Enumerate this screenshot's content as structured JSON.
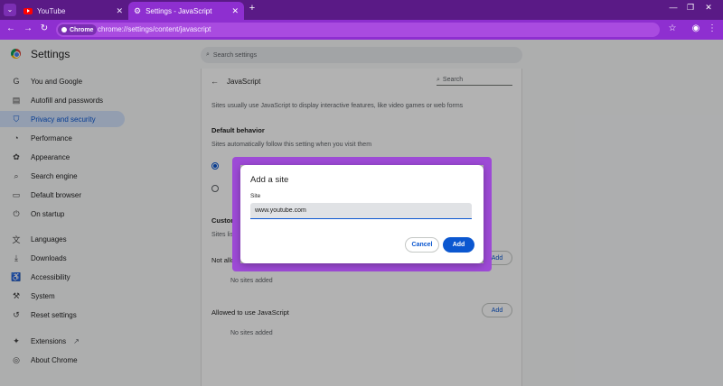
{
  "browser": {
    "tabs": [
      {
        "title": "YouTube",
        "icon": "youtube-icon",
        "active": false
      },
      {
        "title": "Settings - JavaScript",
        "icon": "gear-icon",
        "active": true
      }
    ],
    "new_tab_symbol": "+",
    "url_chip": "Chrome",
    "url": "chrome://settings/content/javascript",
    "accent_color": "#8e2fd0"
  },
  "header": {
    "title": "Settings",
    "search_placeholder": "Search settings"
  },
  "sidebar": {
    "items": [
      {
        "label": "You and Google",
        "icon": "google-g-icon"
      },
      {
        "label": "Autofill and passwords",
        "icon": "clipboard-icon"
      },
      {
        "label": "Privacy and security",
        "icon": "shield-icon",
        "active": true
      },
      {
        "label": "Performance",
        "icon": "speedometer-icon"
      },
      {
        "label": "Appearance",
        "icon": "palette-icon"
      },
      {
        "label": "Search engine",
        "icon": "search-icon"
      },
      {
        "label": "Default browser",
        "icon": "browser-icon"
      },
      {
        "label": "On startup",
        "icon": "power-icon"
      },
      {
        "label": "Languages",
        "icon": "translate-icon"
      },
      {
        "label": "Downloads",
        "icon": "download-icon"
      },
      {
        "label": "Accessibility",
        "icon": "accessibility-icon"
      },
      {
        "label": "System",
        "icon": "wrench-icon"
      },
      {
        "label": "Reset settings",
        "icon": "reset-icon"
      },
      {
        "label": "Extensions",
        "icon": "puzzle-icon"
      },
      {
        "label": "About Chrome",
        "icon": "chrome-icon"
      }
    ]
  },
  "main": {
    "page_title": "JavaScript",
    "search_placeholder": "Search",
    "description": "Sites usually use JavaScript to display interactive features, like video games or web forms",
    "default_behavior": {
      "heading": "Default behavior",
      "subtext": "Sites automatically follow this setting when you visit them"
    },
    "customized_heading": "Custom",
    "customized_subtext": "Sites lis",
    "not_allowed_label": "Not allo",
    "not_allowed_empty": "No sites added",
    "allowed": {
      "label": "Allowed to use JavaScript",
      "add_label": "Add",
      "empty": "No sites added"
    },
    "not_allowed_add_label": "Add"
  },
  "dialog": {
    "title": "Add a site",
    "field_label": "Site",
    "field_value": "www.youtube.com",
    "cancel_label": "Cancel",
    "add_label": "Add",
    "highlight_color": "#9d4ad6"
  }
}
